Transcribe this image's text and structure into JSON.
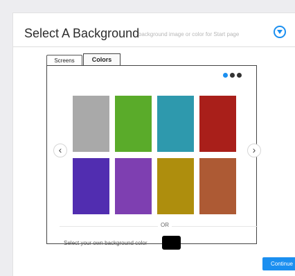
{
  "header": {
    "title": "Select A Background",
    "subtitle": "- background image or color for Start page",
    "menu_icon": "chevron-down-circle-icon"
  },
  "tabs": [
    {
      "label": "Screens",
      "active": false
    },
    {
      "label": "Colors",
      "active": true
    }
  ],
  "pager": {
    "pages": 3,
    "current": 1
  },
  "navigation": {
    "prev_icon": "chevron-left-icon",
    "next_icon": "chevron-right-icon"
  },
  "swatches": [
    {
      "name": "gray",
      "color": "#a9a9a9"
    },
    {
      "name": "green",
      "color": "#5aab2a"
    },
    {
      "name": "teal",
      "color": "#2e99ad"
    },
    {
      "name": "red",
      "color": "#a91f1a"
    },
    {
      "name": "indigo",
      "color": "#512db0"
    },
    {
      "name": "purple",
      "color": "#7e3fb1"
    },
    {
      "name": "olive",
      "color": "#ae8e0d"
    },
    {
      "name": "rust",
      "color": "#ad5a34"
    }
  ],
  "separator": {
    "text": "OR"
  },
  "own_color": {
    "label": "Select your own background color",
    "value": "#000000"
  },
  "footer": {
    "continue_label": "Continue"
  },
  "colors": {
    "accent": "#1b8ff0"
  }
}
